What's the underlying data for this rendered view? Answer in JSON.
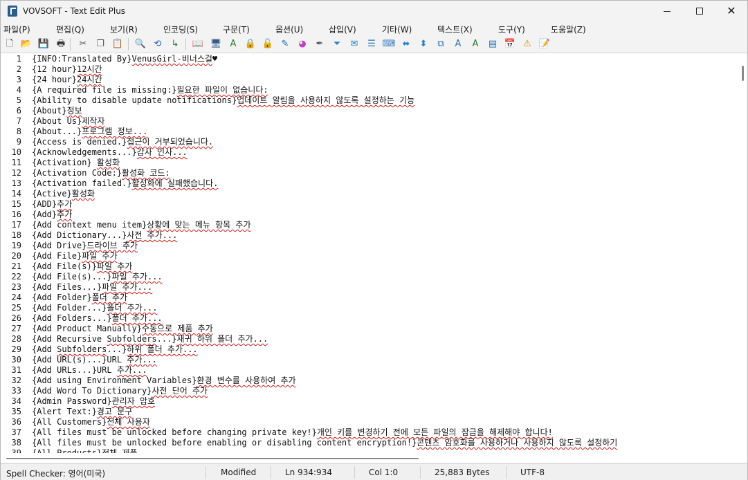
{
  "window": {
    "title": "VOVSOFT - Text Edit Plus",
    "minimize": "—",
    "maximize": "☐",
    "close": "✕"
  },
  "menu": [
    "파일(P)",
    "편집(Q)",
    "보기(R)",
    "인코딩(S)",
    "구문(T)",
    "옵션(U)",
    "삽입(V)",
    "기타(W)",
    "텍스트(X)",
    "도구(Y)",
    "도움말(Z)"
  ],
  "toolbar": {
    "icons": [
      {
        "name": "new-file-icon",
        "glyph": "🗋",
        "color": "#333333"
      },
      {
        "name": "open-folder-icon",
        "glyph": "📂",
        "color": "#c08a1a"
      },
      {
        "name": "save-icon",
        "glyph": "💾",
        "color": "#2f4f7f"
      },
      {
        "name": "print-icon",
        "glyph": "🖶",
        "color": "#333333"
      },
      {
        "name": "cut-icon",
        "glyph": "✂",
        "color": "#555555"
      },
      {
        "name": "copy-icon",
        "glyph": "❐",
        "color": "#555555"
      },
      {
        "name": "paste-icon",
        "glyph": "📋",
        "color": "#a07828"
      },
      {
        "name": "find-icon",
        "glyph": "🔍",
        "color": "#333333"
      },
      {
        "name": "replace-icon",
        "glyph": "⟲",
        "color": "#2060c0"
      },
      {
        "name": "goto-icon",
        "glyph": "↳",
        "color": "#2c7a2c"
      },
      {
        "name": "book-icon",
        "glyph": "📖",
        "color": "#a83232"
      },
      {
        "name": "monitor-icon",
        "glyph": "🖥",
        "color": "#345a8a"
      },
      {
        "name": "spell-check-icon",
        "glyph": "A",
        "color": "#2c7a2c"
      },
      {
        "name": "lock-icon",
        "glyph": "🔒",
        "color": "#c09020"
      },
      {
        "name": "unlock-icon",
        "glyph": "🔓",
        "color": "#c09020"
      },
      {
        "name": "document-edit-icon",
        "glyph": "✎",
        "color": "#2060c0"
      },
      {
        "name": "color-wheel-icon",
        "glyph": "◕",
        "color": "#c040c0"
      },
      {
        "name": "pen-icon",
        "glyph": "✒",
        "color": "#555555"
      },
      {
        "name": "filter-icon",
        "glyph": "⏷",
        "color": "#2a80c0"
      },
      {
        "name": "mail-icon",
        "glyph": "✉",
        "color": "#2a80c0"
      },
      {
        "name": "list-icon",
        "glyph": "☰",
        "color": "#2a70b0"
      },
      {
        "name": "keyboard-icon",
        "glyph": "⌨",
        "color": "#3a78c0"
      },
      {
        "name": "arrows-horizontal-icon",
        "glyph": "⬌",
        "color": "#2a80d0"
      },
      {
        "name": "arrows-vertical-icon",
        "glyph": "⬍",
        "color": "#2a80d0"
      },
      {
        "name": "duplicate-icon",
        "glyph": "⧉",
        "color": "#2a70b0"
      },
      {
        "name": "translate-icon",
        "glyph": "A",
        "color": "#2a70b0"
      },
      {
        "name": "translate-alt-icon",
        "glyph": "A",
        "color": "#2c7a2c"
      },
      {
        "name": "window-icon",
        "glyph": "▤",
        "color": "#2a70b0"
      },
      {
        "name": "calendar-icon",
        "glyph": "📅",
        "color": "#c03030"
      },
      {
        "name": "warning-icon",
        "glyph": "⚠",
        "color": "#d09000"
      },
      {
        "name": "note-icon",
        "glyph": "📝",
        "color": "#b09020"
      }
    ]
  },
  "editor": {
    "lines": [
      {
        "n": "1",
        "segs": [
          [
            "{INFO:Translated By}",
            0
          ],
          [
            "VenusGirl-비너스걸",
            1
          ],
          [
            "♥",
            0
          ]
        ]
      },
      {
        "n": "2",
        "segs": [
          [
            "{12 hour}",
            0
          ],
          [
            "12시간",
            1
          ]
        ]
      },
      {
        "n": "3",
        "segs": [
          [
            "{24 hour}",
            0
          ],
          [
            "24시간",
            1
          ]
        ]
      },
      {
        "n": "4",
        "segs": [
          [
            "{A required file is missing:}",
            0
          ],
          [
            "필요한 파일이 없습니다:",
            1
          ]
        ]
      },
      {
        "n": "5",
        "segs": [
          [
            "{Ability to disable update notifications}",
            0
          ],
          [
            "업데이트 알림을 사용하지 않도록 설정하는 기능",
            1
          ]
        ]
      },
      {
        "n": "6",
        "segs": [
          [
            "{About}",
            0
          ],
          [
            "정보",
            1
          ]
        ]
      },
      {
        "n": "7",
        "segs": [
          [
            "{About Us}",
            0
          ],
          [
            "제작자",
            1
          ]
        ]
      },
      {
        "n": "8",
        "segs": [
          [
            "{About...}",
            0
          ],
          [
            "프로그램 정보...",
            1
          ]
        ]
      },
      {
        "n": "9",
        "segs": [
          [
            "{Access is denied.}",
            0
          ],
          [
            "접근이 거부되었습니다.",
            1
          ]
        ]
      },
      {
        "n": "10",
        "segs": [
          [
            "{Acknowledgements...}",
            0
          ],
          [
            "감사 인사...",
            1
          ]
        ]
      },
      {
        "n": "11",
        "segs": [
          [
            "{Activation} ",
            0
          ],
          [
            "활성화",
            1
          ]
        ]
      },
      {
        "n": "12",
        "segs": [
          [
            "{Activation Code:}",
            0
          ],
          [
            "활성화 코드:",
            1
          ]
        ]
      },
      {
        "n": "13",
        "segs": [
          [
            "{Activation failed.}",
            0
          ],
          [
            "활성화에 실패했습니다.",
            1
          ]
        ]
      },
      {
        "n": "14",
        "segs": [
          [
            "{Active}",
            0
          ],
          [
            "활성화",
            1
          ]
        ]
      },
      {
        "n": "15",
        "segs": [
          [
            "{ADD}",
            0
          ],
          [
            "추가",
            1
          ]
        ]
      },
      {
        "n": "16",
        "segs": [
          [
            "{Add}",
            0
          ],
          [
            "추가",
            1
          ]
        ]
      },
      {
        "n": "17",
        "segs": [
          [
            "{Add context menu item}",
            0
          ],
          [
            "상황에 맞는 메뉴 항목 추가",
            1
          ]
        ]
      },
      {
        "n": "18",
        "segs": [
          [
            "{Add Dictionary...}",
            0
          ],
          [
            "사전 추가...",
            1
          ]
        ]
      },
      {
        "n": "19",
        "segs": [
          [
            "{Add Drive}",
            0
          ],
          [
            "드라이브 추가",
            1
          ]
        ]
      },
      {
        "n": "20",
        "segs": [
          [
            "{Add File}",
            0
          ],
          [
            "파일 추가",
            1
          ]
        ]
      },
      {
        "n": "21",
        "segs": [
          [
            "{Add File(s)}",
            0
          ],
          [
            "파일 추가",
            1
          ]
        ]
      },
      {
        "n": "22",
        "segs": [
          [
            "{Add File(s)...}",
            0
          ],
          [
            "파일 추가...",
            1
          ]
        ]
      },
      {
        "n": "23",
        "segs": [
          [
            "{Add Files...}",
            0
          ],
          [
            "파일 추가...",
            1
          ]
        ]
      },
      {
        "n": "24",
        "segs": [
          [
            "{Add Folder}",
            0
          ],
          [
            "폴더 추가",
            1
          ]
        ]
      },
      {
        "n": "25",
        "segs": [
          [
            "{Add Folder...}",
            0
          ],
          [
            "폴더 추가...",
            1
          ]
        ]
      },
      {
        "n": "26",
        "segs": [
          [
            "{Add Folders...}",
            0
          ],
          [
            "폴더 추가...",
            1
          ]
        ]
      },
      {
        "n": "27",
        "segs": [
          [
            "{Add Product Manually}",
            0
          ],
          [
            "수동으로 제품 추가",
            1
          ]
        ]
      },
      {
        "n": "28",
        "segs": [
          [
            "{Add Recursive ",
            0
          ],
          [
            "Subfolders",
            1
          ],
          [
            "...}",
            0
          ],
          [
            "재귀 하위 폴더 추가...",
            1
          ]
        ]
      },
      {
        "n": "29",
        "segs": [
          [
            "{Add ",
            0
          ],
          [
            "Subfolders",
            1
          ],
          [
            "...}",
            0
          ],
          [
            "하위 폴더 추가...",
            1
          ]
        ]
      },
      {
        "n": "30",
        "segs": [
          [
            "{Add URL(s)...}URL ",
            0
          ],
          [
            "추가...",
            1
          ]
        ]
      },
      {
        "n": "31",
        "segs": [
          [
            "{Add URLs...}URL ",
            0
          ],
          [
            "추가...",
            1
          ]
        ]
      },
      {
        "n": "32",
        "segs": [
          [
            "{Add using Environment Variables}",
            0
          ],
          [
            "환경 변수를 사용하여 추가",
            1
          ]
        ]
      },
      {
        "n": "33",
        "segs": [
          [
            "{Add Word To Dictionary}",
            0
          ],
          [
            "사전 단어 추가",
            1
          ]
        ]
      },
      {
        "n": "34",
        "segs": [
          [
            "{Admin Password}",
            0
          ],
          [
            "관리자 암호",
            1
          ]
        ]
      },
      {
        "n": "35",
        "segs": [
          [
            "{Alert Text:}",
            0
          ],
          [
            "경고 문구",
            1
          ]
        ]
      },
      {
        "n": "36",
        "segs": [
          [
            "{All Customers}",
            0
          ],
          [
            "전체 사용자",
            1
          ]
        ]
      },
      {
        "n": "37",
        "segs": [
          [
            "{All files must be unlocked before changing private key!}",
            0
          ],
          [
            "개인 키를 변경하기 전에 모든 파일의 잠금을 해제해야 합니다!",
            1
          ]
        ]
      },
      {
        "n": "38",
        "segs": [
          [
            "{All files must be unlocked before enabling or disabling content encryption!}",
            0
          ],
          [
            "콘텐츠 암호화를 사용하거나 사용하지 않도록 설정하기",
            1
          ]
        ]
      },
      {
        "n": "39",
        "segs": [
          [
            "{All Products}",
            0
          ],
          [
            "전체 제품",
            1
          ]
        ]
      }
    ]
  },
  "status": {
    "spell_checker": "Spell Checker: 영어(미국)",
    "modified": "Modified",
    "position": "Ln 934:934",
    "column": "Col 1:0",
    "size": "25,883 Bytes",
    "encoding": "UTF-8"
  }
}
